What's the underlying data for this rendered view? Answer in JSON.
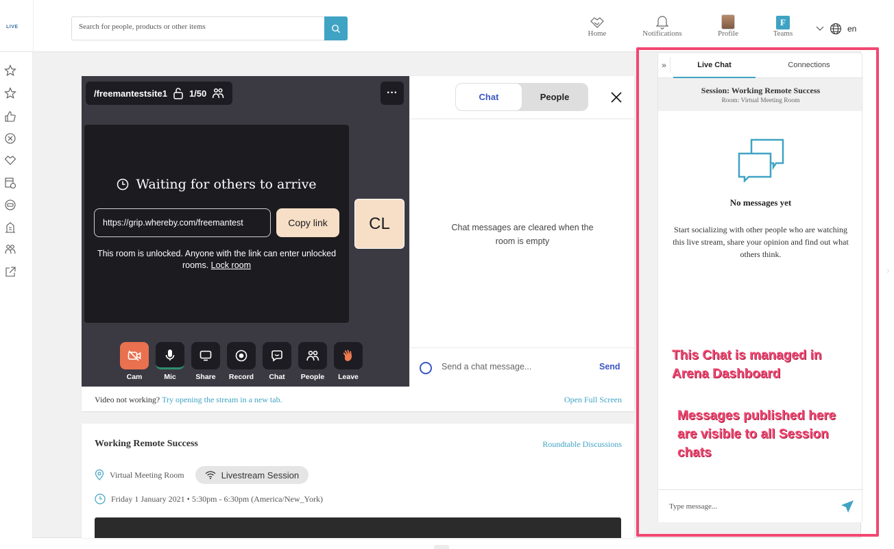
{
  "app": {
    "logo": "LIVE"
  },
  "search": {
    "placeholder": "Search for people, products or other items"
  },
  "nav": {
    "home": "Home",
    "notifications": "Notifications",
    "profile": "Profile",
    "teams": "Teams",
    "teams_badge": "F",
    "language": "en"
  },
  "video": {
    "room_name": "/freemantestsite1",
    "capacity": "1/50",
    "more": "···",
    "waiting_title": "Waiting for others to arrive",
    "room_link": "https://grip.whereby.com/freemantest",
    "copy_link": "Copy link",
    "unlock_text": "This room is unlocked. Anyone with the link can enter unlocked rooms.",
    "lock_room": "Lock room",
    "participant_initials": "CL",
    "tools": {
      "cam": "Cam",
      "mic": "Mic",
      "share": "Share",
      "record": "Record",
      "chat": "Chat",
      "people": "People",
      "leave": "Leave"
    }
  },
  "video_chat": {
    "tab_chat": "Chat",
    "tab_people": "People",
    "empty_text": "Chat messages are cleared when the room is empty",
    "input_placeholder": "Send a chat message...",
    "send": "Send"
  },
  "card_footer": {
    "prefix": "Video not working?",
    "link": "Try opening the stream in a new tab.",
    "fullscreen": "Open Full Screen"
  },
  "session": {
    "title": "Working Remote Success",
    "category": "Roundtable Discussions",
    "location": "Virtual Meeting Room",
    "type_pill": "Livestream Session",
    "datetime": "Friday 1 January 2021 • 5:30pm - 6:30pm (America/New_York)"
  },
  "live_chat": {
    "collapse": "»",
    "tab_live": "Live Chat",
    "tab_connections": "Connections",
    "session_title": "Session: Working Remote Success",
    "session_room": "Room: Virtual Meeting Room",
    "empty_title": "No messages yet",
    "empty_sub": "Start socializing with other people who are watching this live stream, share your opinion and find out what others think.",
    "input_placeholder": "Type message..."
  },
  "annotations": {
    "note1": "This Chat is managed in Arena Dashboard",
    "note2": "Messages published here are visible to all Session chats",
    "color": "#f24772"
  },
  "colors": {
    "accent": "#3fa3c4",
    "whereby_blue": "#3b55c6",
    "cam_off": "#e9714f",
    "tile": "#f6dfc6"
  }
}
